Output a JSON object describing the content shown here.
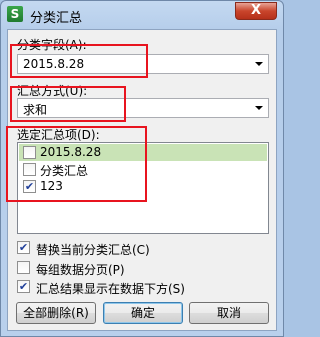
{
  "window": {
    "title": "分类汇总",
    "close_label": "X",
    "app_icon_letter": "S"
  },
  "groupby": {
    "label": "分类字段(A):",
    "value": "2015.8.28"
  },
  "summary": {
    "label": "汇总方式(U):",
    "value": "求和"
  },
  "items": {
    "label": "选定汇总项(D):",
    "rows": [
      {
        "text": "2015.8.28",
        "checked": false,
        "selected": true
      },
      {
        "text": "分类汇总",
        "checked": false,
        "selected": false
      },
      {
        "text": "123",
        "checked": true,
        "selected": false
      }
    ]
  },
  "options": [
    {
      "text": "替换当前分类汇总(C)",
      "checked": true
    },
    {
      "text": "每组数据分页(P)",
      "checked": false
    },
    {
      "text": "汇总结果显示在数据下方(S)",
      "checked": true
    }
  ],
  "buttons": {
    "remove_all": "全部删除(R)",
    "ok": "确定",
    "cancel": "取消"
  },
  "check_glyph": "✔",
  "colors": {
    "highlight": "#e8141f",
    "selected_row": "#c9e3b6"
  }
}
